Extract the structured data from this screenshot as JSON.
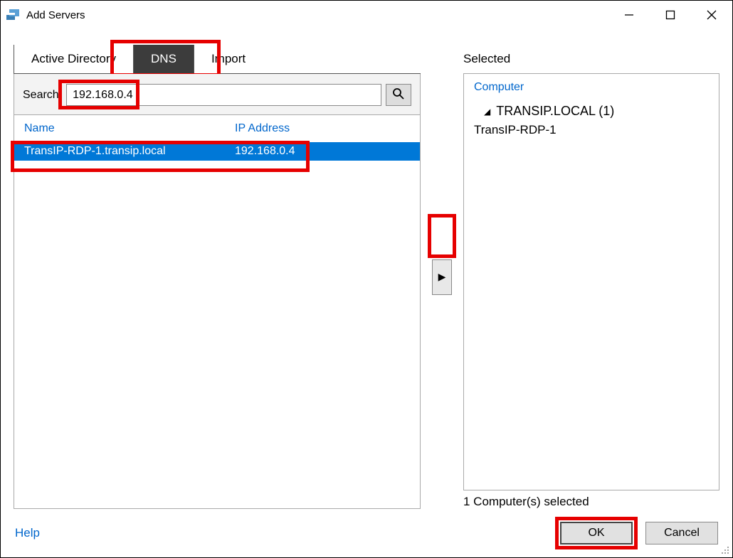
{
  "window": {
    "title": "Add Servers"
  },
  "tabs": {
    "items": [
      "Active Directory",
      "DNS",
      "Import"
    ],
    "active_index": 1
  },
  "search": {
    "label": "Search:",
    "value": "192.168.0.4"
  },
  "results": {
    "columns": {
      "name": "Name",
      "ip": "IP Address"
    },
    "rows": [
      {
        "name": "TransIP-RDP-1.transip.local",
        "ip": "192.168.0.4"
      }
    ]
  },
  "selected": {
    "heading": "Selected",
    "column": "Computer",
    "group": "TRANSIP.LOCAL (1)",
    "items": [
      "TransIP-RDP-1"
    ],
    "count_text": "1 Computer(s) selected"
  },
  "footer": {
    "help": "Help",
    "ok": "OK",
    "cancel": "Cancel"
  }
}
